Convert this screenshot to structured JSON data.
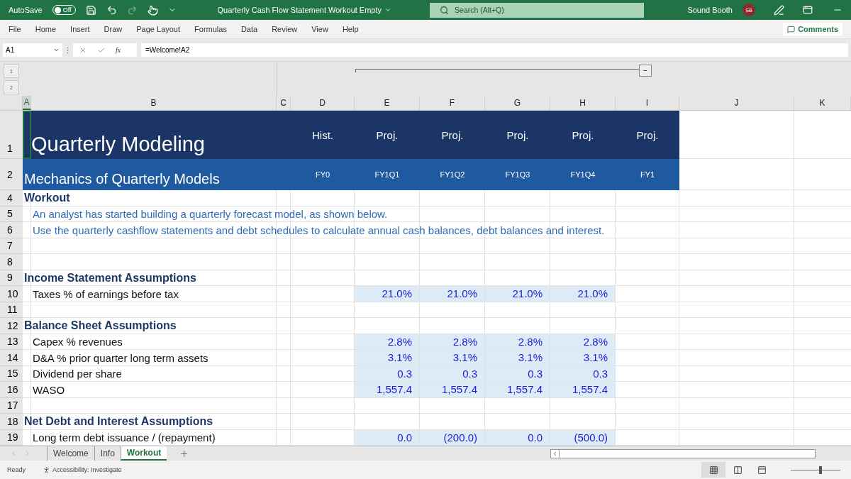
{
  "title_bar": {
    "autosave_label": "AutoSave",
    "autosave": {
      "on": false,
      "label": "Off"
    },
    "document_title": "Quarterly Cash Flow Statement Workout Empty",
    "search": {
      "placeholder": "Search (Alt+Q)"
    },
    "user_name": "Sound Booth",
    "user_initials": "SB"
  },
  "menu": [
    {
      "label": "File",
      "selected": false
    },
    {
      "label": "Home",
      "selected": false
    },
    {
      "label": "Insert",
      "selected": false
    },
    {
      "label": "Draw",
      "selected": false
    },
    {
      "label": "Page Layout",
      "selected": false
    },
    {
      "label": "Formulas",
      "selected": false
    },
    {
      "label": "Data",
      "selected": false
    },
    {
      "label": "Review",
      "selected": false
    },
    {
      "label": "View",
      "selected": false
    },
    {
      "label": "Help",
      "selected": false
    }
  ],
  "comments_button": "Comments",
  "formula_bar": {
    "name_box": "A1",
    "fx": "fx",
    "formula": "=Welcome!A2"
  },
  "outline": {
    "levels": [
      "1",
      "2"
    ],
    "collapse": "−"
  },
  "columns": [
    {
      "label": "A",
      "selected": true
    },
    {
      "label": "B",
      "selected": false
    },
    {
      "label": "C",
      "selected": false
    },
    {
      "label": "D",
      "selected": false
    },
    {
      "label": "E",
      "selected": false
    },
    {
      "label": "F",
      "selected": false
    },
    {
      "label": "G",
      "selected": false
    },
    {
      "label": "H",
      "selected": false
    },
    {
      "label": "I",
      "selected": false
    },
    {
      "label": "J",
      "selected": false
    },
    {
      "label": "K",
      "selected": false
    }
  ],
  "rows": [
    {
      "number": "1",
      "kind": "title",
      "text": "Quarterly Modeling",
      "values": [
        "Hist.",
        "Proj.",
        "Proj.",
        "Proj.",
        "Proj.",
        "Proj."
      ]
    },
    {
      "number": "2",
      "kind": "subtitle",
      "text": "Mechanics of Quarterly Models",
      "values": [
        "FY0",
        "FY1Q1",
        "FY1Q2",
        "FY1Q3",
        "FY1Q4",
        "FY1"
      ]
    },
    {
      "number": "4",
      "kind": "section",
      "text": "Workout"
    },
    {
      "number": "5",
      "kind": "note",
      "text": "An analyst has started building a quarterly forecast model, as shown below."
    },
    {
      "number": "6",
      "kind": "note",
      "text": "Use the quarterly cashflow statements and debt schedules to calculate annual cash balances, debt balances and interest."
    },
    {
      "number": "7",
      "kind": "blank"
    },
    {
      "number": "8",
      "kind": "blank"
    },
    {
      "number": "9",
      "kind": "section",
      "text": "Income Statement Assumptions"
    },
    {
      "number": "10",
      "kind": "input",
      "text": "Taxes % of earnings before tax",
      "values": [
        "21.0%",
        "21.0%",
        "21.0%",
        "21.0%"
      ]
    },
    {
      "number": "11",
      "kind": "blank"
    },
    {
      "number": "12",
      "kind": "section",
      "text": "Balance Sheet Assumptions"
    },
    {
      "number": "13",
      "kind": "input",
      "text": "Capex % revenues",
      "values": [
        "2.8%",
        "2.8%",
        "2.8%",
        "2.8%"
      ]
    },
    {
      "number": "14",
      "kind": "input",
      "text": "D&A % prior quarter long term assets",
      "values": [
        "3.1%",
        "3.1%",
        "3.1%",
        "3.1%"
      ]
    },
    {
      "number": "15",
      "kind": "input",
      "text": "Dividend per share",
      "values": [
        "0.3",
        "0.3",
        "0.3",
        "0.3"
      ]
    },
    {
      "number": "16",
      "kind": "input",
      "text": "WASO",
      "values": [
        "1,557.4",
        "1,557.4",
        "1,557.4",
        "1,557.4"
      ]
    },
    {
      "number": "17",
      "kind": "blank"
    },
    {
      "number": "18",
      "kind": "section",
      "text": "Net Debt and Interest Assumptions"
    },
    {
      "number": "19",
      "kind": "input",
      "text": "Long term debt issuance / (repayment)",
      "values": [
        "0.0",
        "(200.0)",
        "0.0",
        "(500.0)"
      ]
    }
  ],
  "sheet_tabs": [
    {
      "label": "Welcome",
      "selected": false
    },
    {
      "label": "Info",
      "selected": false
    },
    {
      "label": "Workout",
      "selected": true
    }
  ],
  "status_bar": {
    "status": "Ready",
    "accessibility": "Accessibility: Investigate",
    "views": [
      {
        "kind": "normal",
        "selected": true
      },
      {
        "kind": "page-layout",
        "selected": false
      },
      {
        "kind": "page-break",
        "selected": false
      }
    ],
    "zoom": {
      "level": 0.6
    }
  }
}
